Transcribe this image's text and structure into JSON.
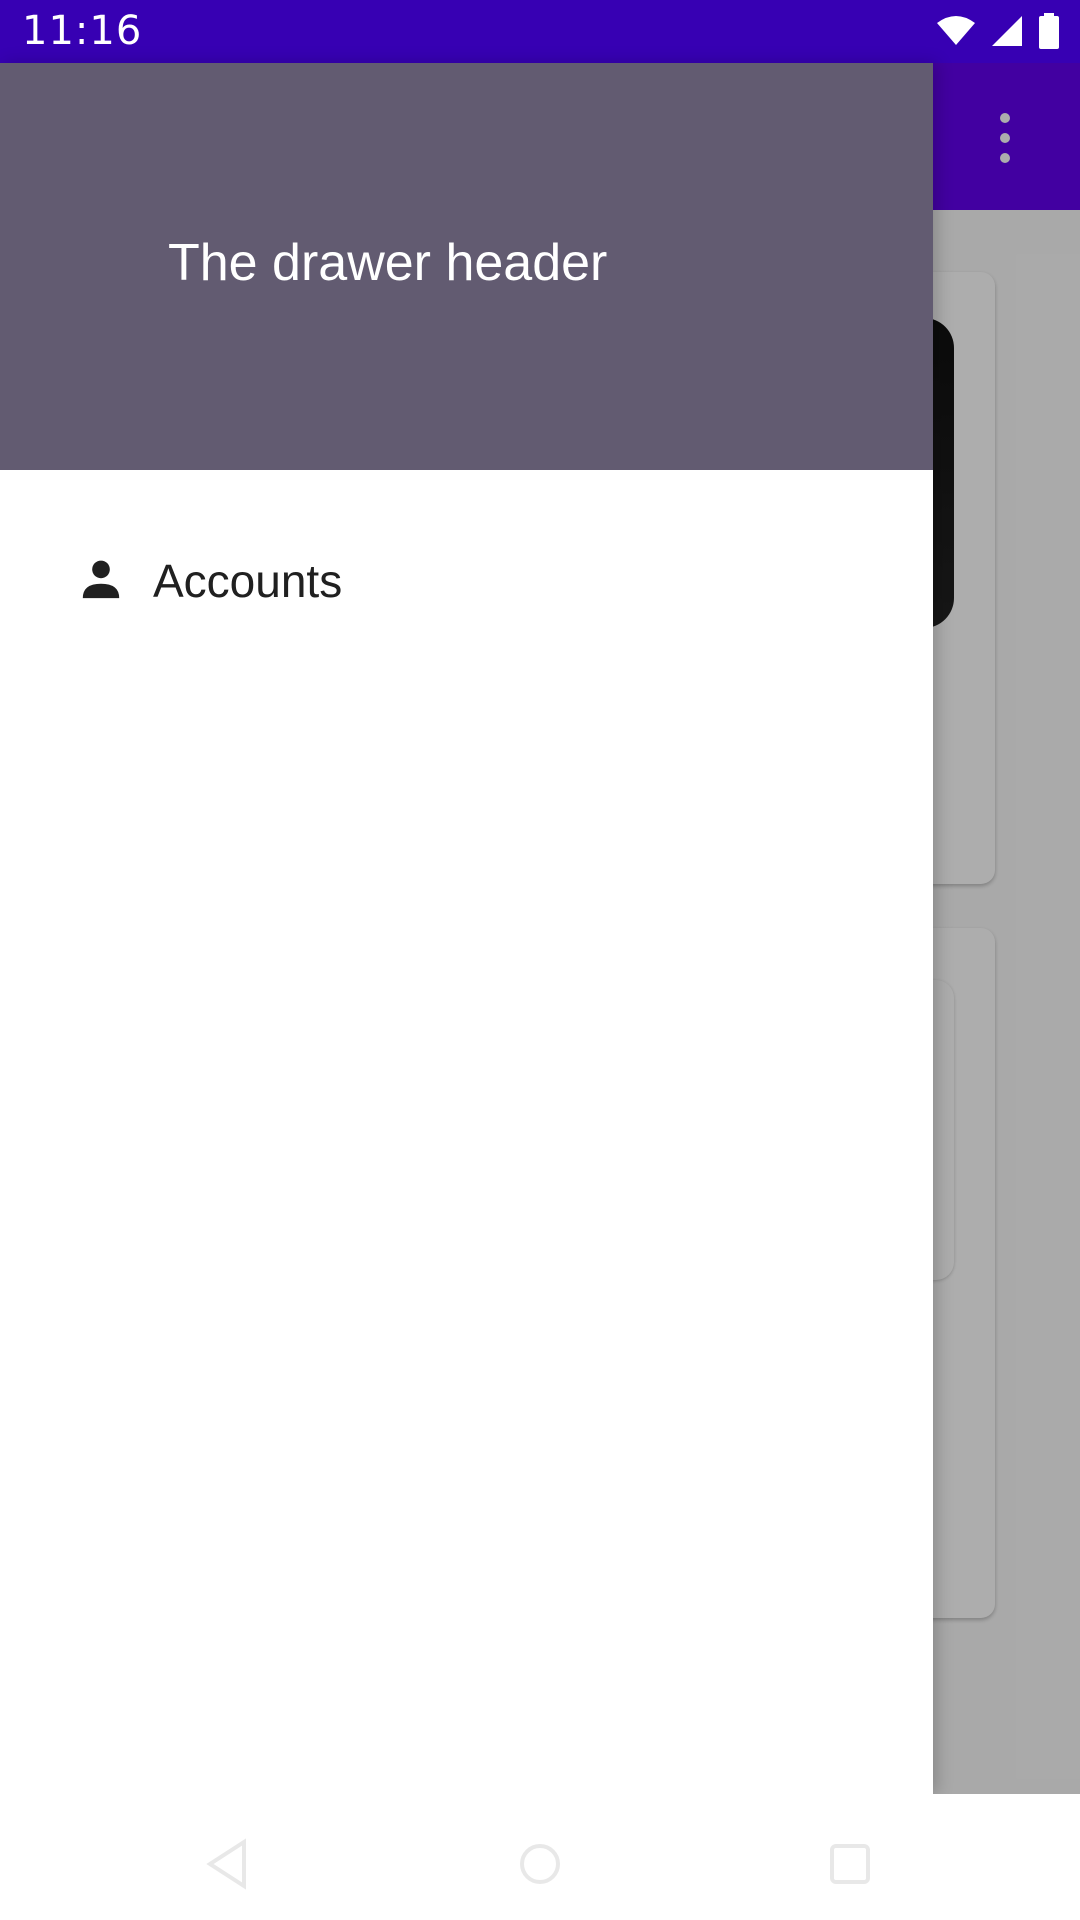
{
  "status_bar": {
    "time": "11:16",
    "icons": [
      "wifi-icon",
      "signal-icon",
      "battery-icon"
    ],
    "background": "#3700b3"
  },
  "toolbar": {
    "menu_icon": "more-vert-icon",
    "background": "#6200ee"
  },
  "drawer": {
    "header_title": "The drawer header",
    "header_background": "#625b71",
    "items": [
      {
        "label": "Accounts",
        "icon": "person-icon"
      }
    ]
  },
  "nav_bar": {
    "buttons": [
      "back-icon",
      "home-icon",
      "recents-icon"
    ]
  }
}
